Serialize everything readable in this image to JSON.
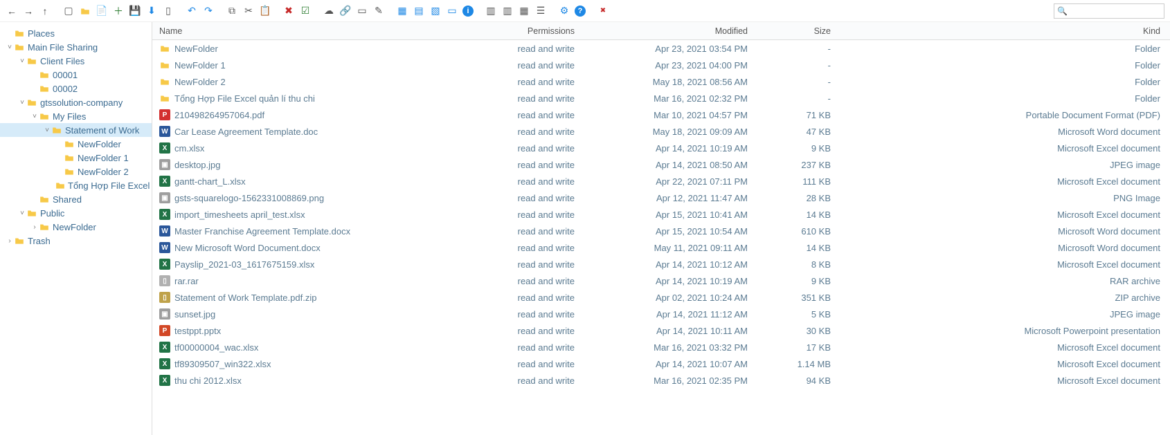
{
  "toolbar": {
    "nav": [
      "back",
      "forward",
      "up"
    ],
    "group2": [
      "new-window",
      "new-folder",
      "new-file",
      "add",
      "save",
      "download",
      "rename"
    ],
    "group3": [
      "undo",
      "redo"
    ],
    "group4": [
      "copy",
      "cut",
      "paste"
    ],
    "group5": [
      "delete",
      "select-all"
    ],
    "group6": [
      "share",
      "link",
      "rename2",
      "edit"
    ],
    "group7": [
      "tiles",
      "grid",
      "thumbs",
      "slideshow",
      "info"
    ],
    "group8": [
      "sort1",
      "sort2",
      "grid2",
      "list"
    ],
    "group9": [
      "settings",
      "help"
    ],
    "group10": [
      "close"
    ],
    "search_placeholder": ""
  },
  "tree": [
    {
      "depth": 0,
      "tw": "",
      "label": "Places"
    },
    {
      "depth": 0,
      "tw": "˅",
      "label": "Main File Sharing"
    },
    {
      "depth": 1,
      "tw": "˅",
      "label": "Client Files"
    },
    {
      "depth": 2,
      "tw": "",
      "label": "00001"
    },
    {
      "depth": 2,
      "tw": "",
      "label": "00002"
    },
    {
      "depth": 1,
      "tw": "˅",
      "label": "gtssolution-company"
    },
    {
      "depth": 2,
      "tw": "˅",
      "label": "My Files"
    },
    {
      "depth": 3,
      "tw": "˅",
      "label": "Statement of Work",
      "selected": true
    },
    {
      "depth": 4,
      "tw": "",
      "label": "NewFolder"
    },
    {
      "depth": 4,
      "tw": "",
      "label": "NewFolder 1"
    },
    {
      "depth": 4,
      "tw": "",
      "label": "NewFolder 2"
    },
    {
      "depth": 4,
      "tw": "",
      "label": "Tổng Hợp File Excel quản l"
    },
    {
      "depth": 2,
      "tw": "",
      "label": "Shared"
    },
    {
      "depth": 1,
      "tw": "˅",
      "label": "Public"
    },
    {
      "depth": 2,
      "tw": ">",
      "label": "NewFolder"
    },
    {
      "depth": 0,
      "tw": ">",
      "label": "Trash"
    }
  ],
  "columns": {
    "name": "Name",
    "permissions": "Permissions",
    "modified": "Modified",
    "size": "Size",
    "kind": "Kind"
  },
  "files": [
    {
      "icon": "folder",
      "name": "NewFolder",
      "perm": "read and write",
      "mod": "Apr 23, 2021 03:54 PM",
      "size": "-",
      "kind": "Folder"
    },
    {
      "icon": "folder",
      "name": "NewFolder 1",
      "perm": "read and write",
      "mod": "Apr 23, 2021 04:00 PM",
      "size": "-",
      "kind": "Folder"
    },
    {
      "icon": "folder",
      "name": "NewFolder 2",
      "perm": "read and write",
      "mod": "May 18, 2021 08:56 AM",
      "size": "-",
      "kind": "Folder"
    },
    {
      "icon": "folder",
      "name": "Tổng Hợp File Excel quản lí thu chi",
      "perm": "read and write",
      "mod": "Mar 16, 2021 02:32 PM",
      "size": "-",
      "kind": "Folder"
    },
    {
      "icon": "pdf",
      "name": "210498264957064.pdf",
      "perm": "read and write",
      "mod": "Mar 10, 2021 04:57 PM",
      "size": "71 KB",
      "kind": "Portable Document Format (PDF)"
    },
    {
      "icon": "doc",
      "name": "Car Lease Agreement Template.doc",
      "perm": "read and write",
      "mod": "May 18, 2021 09:09 AM",
      "size": "47 KB",
      "kind": "Microsoft Word document"
    },
    {
      "icon": "xls",
      "name": "cm.xlsx",
      "perm": "read and write",
      "mod": "Apr 14, 2021 10:19 AM",
      "size": "9 KB",
      "kind": "Microsoft Excel document"
    },
    {
      "icon": "img",
      "name": "desktop.jpg",
      "perm": "read and write",
      "mod": "Apr 14, 2021 08:50 AM",
      "size": "237 KB",
      "kind": "JPEG image"
    },
    {
      "icon": "xls",
      "name": "gantt-chart_L.xlsx",
      "perm": "read and write",
      "mod": "Apr 22, 2021 07:11 PM",
      "size": "111 KB",
      "kind": "Microsoft Excel document"
    },
    {
      "icon": "png",
      "name": "gsts-squarelogo-1562331008869.png",
      "perm": "read and write",
      "mod": "Apr 12, 2021 11:47 AM",
      "size": "28 KB",
      "kind": "PNG Image"
    },
    {
      "icon": "xls",
      "name": "import_timesheets april_test.xlsx",
      "perm": "read and write",
      "mod": "Apr 15, 2021 10:41 AM",
      "size": "14 KB",
      "kind": "Microsoft Excel document"
    },
    {
      "icon": "doc",
      "name": "Master Franchise Agreement Template.docx",
      "perm": "read and write",
      "mod": "Apr 15, 2021 10:54 AM",
      "size": "610 KB",
      "kind": "Microsoft Word document"
    },
    {
      "icon": "doc",
      "name": "New Microsoft Word Document.docx",
      "perm": "read and write",
      "mod": "May 11, 2021 09:11 AM",
      "size": "14 KB",
      "kind": "Microsoft Word document"
    },
    {
      "icon": "xls",
      "name": "Payslip_2021-03_1617675159.xlsx",
      "perm": "read and write",
      "mod": "Apr 14, 2021 10:12 AM",
      "size": "8 KB",
      "kind": "Microsoft Excel document"
    },
    {
      "icon": "rar",
      "name": "rar.rar",
      "perm": "read and write",
      "mod": "Apr 14, 2021 10:19 AM",
      "size": "9 KB",
      "kind": "RAR archive"
    },
    {
      "icon": "zip",
      "name": "Statement of Work Template.pdf.zip",
      "perm": "read and write",
      "mod": "Apr 02, 2021 10:24 AM",
      "size": "351 KB",
      "kind": "ZIP archive"
    },
    {
      "icon": "img",
      "name": "sunset.jpg",
      "perm": "read and write",
      "mod": "Apr 14, 2021 11:12 AM",
      "size": "5 KB",
      "kind": "JPEG image"
    },
    {
      "icon": "ppt",
      "name": "testppt.pptx",
      "perm": "read and write",
      "mod": "Apr 14, 2021 10:11 AM",
      "size": "30 KB",
      "kind": "Microsoft Powerpoint presentation"
    },
    {
      "icon": "xls",
      "name": "tf00000004_wac.xlsx",
      "perm": "read and write",
      "mod": "Mar 16, 2021 03:32 PM",
      "size": "17 KB",
      "kind": "Microsoft Excel document"
    },
    {
      "icon": "xls",
      "name": "tf89309507_win322.xlsx",
      "perm": "read and write",
      "mod": "Apr 14, 2021 10:07 AM",
      "size": "1.14 MB",
      "kind": "Microsoft Excel document"
    },
    {
      "icon": "xls",
      "name": "thu chi 2012.xlsx",
      "perm": "read and write",
      "mod": "Mar 16, 2021 02:35 PM",
      "size": "94 KB",
      "kind": "Microsoft Excel document"
    }
  ]
}
